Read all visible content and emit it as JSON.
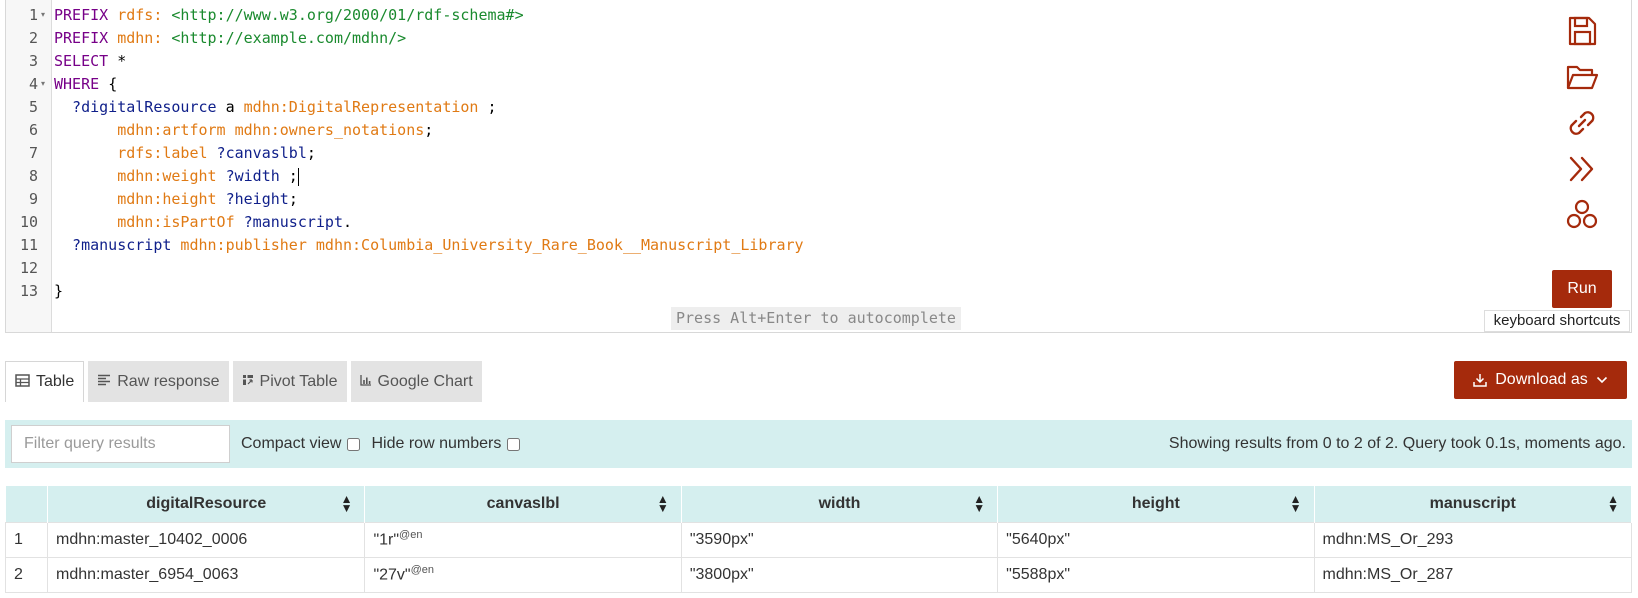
{
  "editor": {
    "line_numbers": [
      "1",
      "2",
      "3",
      "4",
      "5",
      "6",
      "7",
      "8",
      "9",
      "10",
      "11",
      "12",
      "13"
    ],
    "lines": {
      "l1": {
        "kw": "PREFIX ",
        "pfx": "rdfs:",
        "uri": " <http://www.w3.org/2000/01/rdf-schema#>"
      },
      "l2": {
        "kw": "PREFIX ",
        "pfx": "mdhn:",
        "uri": " <http://example.com/mdhn/>"
      },
      "l3": {
        "kw": "SELECT ",
        "rest": "*"
      },
      "l4": {
        "kw": "WHERE ",
        "rest": "{"
      },
      "l5": {
        "var": "  ?digitalResource",
        "a": " a ",
        "pfx": "mdhn:DigitalRepresentation",
        "rest": " ;"
      },
      "l6": {
        "pfx1": "       mdhn:artform",
        "pfx2": " mdhn:owners_notations",
        "rest": ";"
      },
      "l7": {
        "pfx": "       rdfs:label",
        "var": " ?canvaslbl",
        "rest": ";"
      },
      "l8": {
        "pfx": "       mdhn:weight",
        "var": " ?width",
        "rest": " ;"
      },
      "l9": {
        "pfx": "       mdhn:height",
        "var": " ?height",
        "rest": ";"
      },
      "l10": {
        "pfx": "       mdhn:isPartOf",
        "var": " ?manuscript",
        "rest": "."
      },
      "l11": {
        "var": "  ?manuscript",
        "pfx1": " mdhn:publisher",
        "pfx2": " mdhn:Columbia_University_Rare_Book__Manuscript_Library"
      },
      "l13": {
        "rest": "}"
      }
    },
    "autocomplete_hint": "Press Alt+Enter to autocomplete",
    "side_buttons": [
      "save-icon",
      "folder-open-icon",
      "link-icon",
      "double-chevron-right-icon",
      "network-icon"
    ],
    "run_label": "Run",
    "keyboard_shortcuts_label": "keyboard shortcuts"
  },
  "tabs": [
    {
      "label": "Table",
      "icon": "table-icon",
      "active": true
    },
    {
      "label": "Raw response",
      "icon": "align-left-icon",
      "active": false
    },
    {
      "label": "Pivot Table",
      "icon": "pivot-icon",
      "active": false
    },
    {
      "label": "Google Chart",
      "icon": "bar-chart-icon",
      "active": false
    }
  ],
  "download_label": "Download as",
  "controls": {
    "filter_placeholder": "Filter query results",
    "compact_view_label": "Compact view",
    "hide_row_numbers_label": "Hide row numbers",
    "status": "Showing results from 0 to 2 of 2. Query took 0.1s, moments ago."
  },
  "table": {
    "headers": [
      "digitalResource",
      "canvaslbl",
      "width",
      "height",
      "manuscript"
    ],
    "rows": [
      {
        "num": "1",
        "digitalResource": "mdhn:master_10402_0006",
        "canvaslbl": "\"1r\"",
        "lang": "@en",
        "width": "\"3590px\"",
        "height": "\"5640px\"",
        "manuscript": "mdhn:MS_Or_293"
      },
      {
        "num": "2",
        "digitalResource": "mdhn:master_6954_0063",
        "canvaslbl": "\"27v\"",
        "lang": "@en",
        "width": "\"3800px\"",
        "height": "\"5588px\"",
        "manuscript": "mdhn:MS_Or_287"
      }
    ]
  },
  "colors": {
    "accent": "#a52a0c",
    "results_bar": "#d5efef",
    "keyword": "#770088",
    "prefix": "#e07a14",
    "uri": "#1a8a2e",
    "variable": "#0f1f8a"
  }
}
